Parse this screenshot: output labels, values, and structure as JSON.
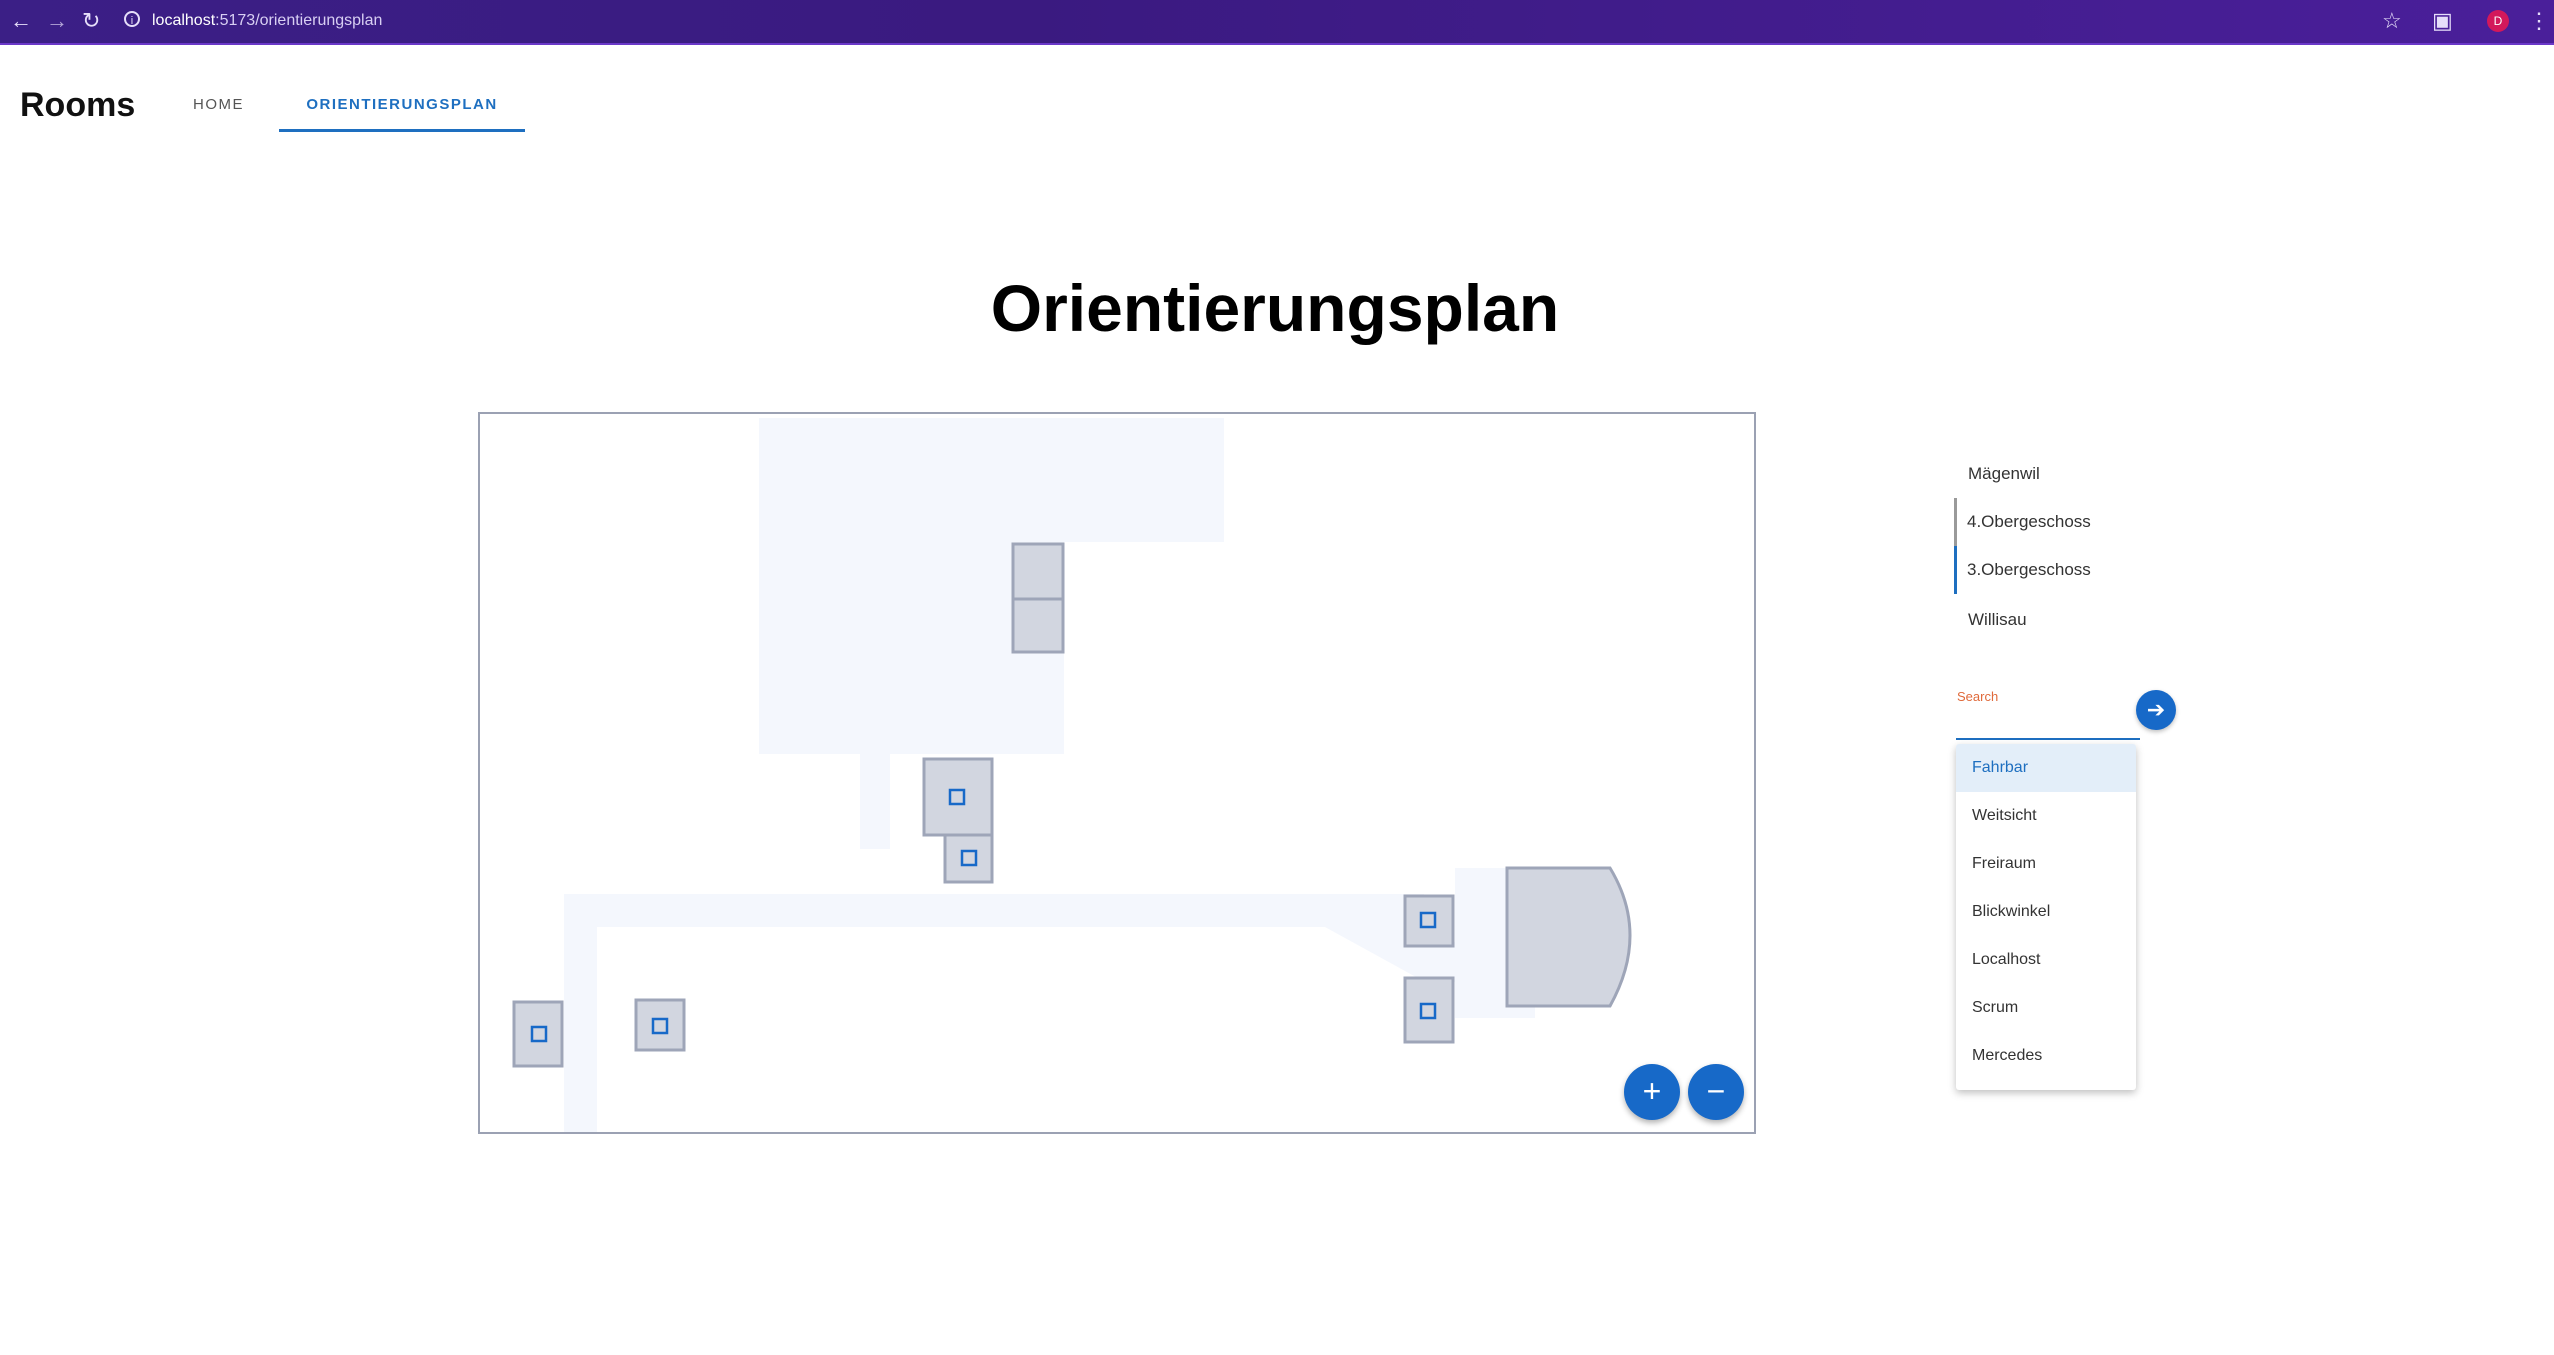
{
  "browser": {
    "url_host": "localhost",
    "url_rest": ":5173/orientierungsplan",
    "avatar_letter": "D",
    "accent": "#3b1f86"
  },
  "header": {
    "brand": "Rooms",
    "tabs": [
      {
        "label": "HOME",
        "active": false
      },
      {
        "label": "ORIENTIERUNGSPLAN",
        "active": true
      }
    ]
  },
  "page": {
    "title": "Orientierungsplan"
  },
  "map": {
    "zoom_in_label": "+",
    "zoom_out_label": "−",
    "room_color": "#d2d6e0",
    "corridor_color": "#f4f7fd",
    "accent": "#1769c8"
  },
  "sidebar": {
    "locations": [
      {
        "label": "Mägenwil",
        "level": 0
      },
      {
        "label": "4.Obergeschoss",
        "level": 1,
        "selected": false
      },
      {
        "label": "3.Obergeschoss",
        "level": 1,
        "selected": true
      },
      {
        "label": "Willisau",
        "level": 0
      }
    ],
    "search": {
      "label": "Search",
      "value": "",
      "button_icon": "arrow-right-icon"
    },
    "options": [
      "Fahrbar",
      "Weitsicht",
      "Freiraum",
      "Blickwinkel",
      "Localhost",
      "Scrum",
      "Mercedes"
    ],
    "highlighted_option": "Fahrbar"
  }
}
